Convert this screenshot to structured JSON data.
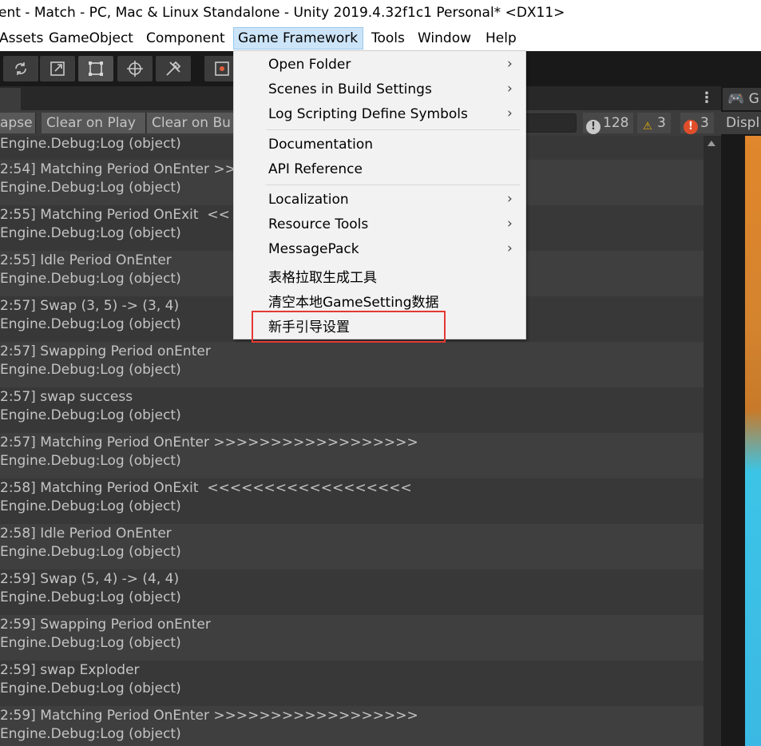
{
  "window": {
    "title": "ent - Match - PC, Mac & Linux Standalone - Unity 2019.4.32f1c1 Personal* <DX11>"
  },
  "menubar": {
    "items": [
      "Assets",
      "GameObject",
      "Component",
      "Game Framework",
      "Tools",
      "Window",
      "Help"
    ]
  },
  "console": {
    "toolbar": {
      "collapse": "apse",
      "clear_on_play": "Clear on Play",
      "clear_on_build": "Clear on Bu"
    },
    "counts": {
      "logs": "128",
      "warnings": "3",
      "errors": "3"
    },
    "first_line": "Engine.Debug:Log (object)",
    "entries": [
      {
        "msg": "2:54] Matching Period OnEnter >>",
        "trace": "Engine.Debug:Log (object)"
      },
      {
        "msg": "2:55] Matching Period OnExit  <<",
        "trace": "Engine.Debug:Log (object)"
      },
      {
        "msg": "2:55] Idle Period OnEnter",
        "trace": "Engine.Debug:Log (object)"
      },
      {
        "msg": "2:57] Swap (3, 5) -> (3, 4)",
        "trace": "Engine.Debug:Log (object)"
      },
      {
        "msg": "2:57] Swapping Period onEnter",
        "trace": "Engine.Debug:Log (object)"
      },
      {
        "msg": "2:57] swap success",
        "trace": "Engine.Debug:Log (object)"
      },
      {
        "msg": "2:57] Matching Period OnEnter >>>>>>>>>>>>>>>>>>",
        "trace": "Engine.Debug:Log (object)"
      },
      {
        "msg": "2:58] Matching Period OnExit  <<<<<<<<<<<<<<<<<<",
        "trace": "Engine.Debug:Log (object)"
      },
      {
        "msg": "2:58] Idle Period OnEnter",
        "trace": "Engine.Debug:Log (object)"
      },
      {
        "msg": "2:59] Swap (5, 4) -> (4, 4)",
        "trace": "Engine.Debug:Log (object)"
      },
      {
        "msg": "2:59] Swapping Period onEnter",
        "trace": "Engine.Debug:Log (object)"
      },
      {
        "msg": "2:59] swap Exploder",
        "trace": "Engine.Debug:Log (object)"
      },
      {
        "msg": "2:59] Matching Period OnEnter >>>>>>>>>>>>>>>>>>",
        "trace": "Engine.Debug:Log (object)"
      }
    ]
  },
  "game_panel": {
    "tab": "G",
    "display": "Displ"
  },
  "dropdown": {
    "items": [
      {
        "label": "Open Folder",
        "submenu": true
      },
      {
        "label": "Scenes in Build Settings",
        "submenu": true
      },
      {
        "label": "Log Scripting Define Symbols",
        "submenu": true
      },
      {
        "label": "Documentation",
        "submenu": false
      },
      {
        "label": "API Reference",
        "submenu": false
      },
      {
        "label": "Localization",
        "submenu": true
      },
      {
        "label": "Resource Tools",
        "submenu": true
      },
      {
        "label": "MessagePack",
        "submenu": true
      },
      {
        "label": "表格拉取生成工具",
        "submenu": false
      },
      {
        "label": "清空本地GameSetting数据",
        "submenu": false
      },
      {
        "label": "新手引导设置",
        "submenu": false
      }
    ],
    "arrow": "›"
  },
  "colors": {
    "highlight_box": "#e53935",
    "menu_active": "#cce4f7",
    "error": "#e04e2a",
    "warning": "#f0b400"
  }
}
